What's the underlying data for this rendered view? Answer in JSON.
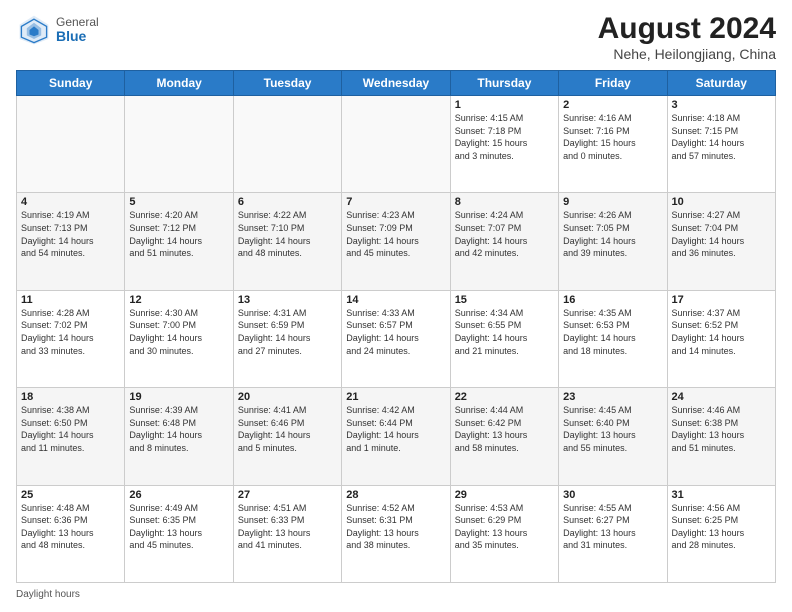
{
  "header": {
    "logo_general": "General",
    "logo_blue": "Blue",
    "title": "August 2024",
    "subtitle": "Nehe, Heilongjiang, China"
  },
  "days_of_week": [
    "Sunday",
    "Monday",
    "Tuesday",
    "Wednesday",
    "Thursday",
    "Friday",
    "Saturday"
  ],
  "footer_text": "Daylight hours",
  "weeks": [
    [
      {
        "day": "",
        "info": ""
      },
      {
        "day": "",
        "info": ""
      },
      {
        "day": "",
        "info": ""
      },
      {
        "day": "",
        "info": ""
      },
      {
        "day": "1",
        "info": "Sunrise: 4:15 AM\nSunset: 7:18 PM\nDaylight: 15 hours\nand 3 minutes."
      },
      {
        "day": "2",
        "info": "Sunrise: 4:16 AM\nSunset: 7:16 PM\nDaylight: 15 hours\nand 0 minutes."
      },
      {
        "day": "3",
        "info": "Sunrise: 4:18 AM\nSunset: 7:15 PM\nDaylight: 14 hours\nand 57 minutes."
      }
    ],
    [
      {
        "day": "4",
        "info": "Sunrise: 4:19 AM\nSunset: 7:13 PM\nDaylight: 14 hours\nand 54 minutes."
      },
      {
        "day": "5",
        "info": "Sunrise: 4:20 AM\nSunset: 7:12 PM\nDaylight: 14 hours\nand 51 minutes."
      },
      {
        "day": "6",
        "info": "Sunrise: 4:22 AM\nSunset: 7:10 PM\nDaylight: 14 hours\nand 48 minutes."
      },
      {
        "day": "7",
        "info": "Sunrise: 4:23 AM\nSunset: 7:09 PM\nDaylight: 14 hours\nand 45 minutes."
      },
      {
        "day": "8",
        "info": "Sunrise: 4:24 AM\nSunset: 7:07 PM\nDaylight: 14 hours\nand 42 minutes."
      },
      {
        "day": "9",
        "info": "Sunrise: 4:26 AM\nSunset: 7:05 PM\nDaylight: 14 hours\nand 39 minutes."
      },
      {
        "day": "10",
        "info": "Sunrise: 4:27 AM\nSunset: 7:04 PM\nDaylight: 14 hours\nand 36 minutes."
      }
    ],
    [
      {
        "day": "11",
        "info": "Sunrise: 4:28 AM\nSunset: 7:02 PM\nDaylight: 14 hours\nand 33 minutes."
      },
      {
        "day": "12",
        "info": "Sunrise: 4:30 AM\nSunset: 7:00 PM\nDaylight: 14 hours\nand 30 minutes."
      },
      {
        "day": "13",
        "info": "Sunrise: 4:31 AM\nSunset: 6:59 PM\nDaylight: 14 hours\nand 27 minutes."
      },
      {
        "day": "14",
        "info": "Sunrise: 4:33 AM\nSunset: 6:57 PM\nDaylight: 14 hours\nand 24 minutes."
      },
      {
        "day": "15",
        "info": "Sunrise: 4:34 AM\nSunset: 6:55 PM\nDaylight: 14 hours\nand 21 minutes."
      },
      {
        "day": "16",
        "info": "Sunrise: 4:35 AM\nSunset: 6:53 PM\nDaylight: 14 hours\nand 18 minutes."
      },
      {
        "day": "17",
        "info": "Sunrise: 4:37 AM\nSunset: 6:52 PM\nDaylight: 14 hours\nand 14 minutes."
      }
    ],
    [
      {
        "day": "18",
        "info": "Sunrise: 4:38 AM\nSunset: 6:50 PM\nDaylight: 14 hours\nand 11 minutes."
      },
      {
        "day": "19",
        "info": "Sunrise: 4:39 AM\nSunset: 6:48 PM\nDaylight: 14 hours\nand 8 minutes."
      },
      {
        "day": "20",
        "info": "Sunrise: 4:41 AM\nSunset: 6:46 PM\nDaylight: 14 hours\nand 5 minutes."
      },
      {
        "day": "21",
        "info": "Sunrise: 4:42 AM\nSunset: 6:44 PM\nDaylight: 14 hours\nand 1 minute."
      },
      {
        "day": "22",
        "info": "Sunrise: 4:44 AM\nSunset: 6:42 PM\nDaylight: 13 hours\nand 58 minutes."
      },
      {
        "day": "23",
        "info": "Sunrise: 4:45 AM\nSunset: 6:40 PM\nDaylight: 13 hours\nand 55 minutes."
      },
      {
        "day": "24",
        "info": "Sunrise: 4:46 AM\nSunset: 6:38 PM\nDaylight: 13 hours\nand 51 minutes."
      }
    ],
    [
      {
        "day": "25",
        "info": "Sunrise: 4:48 AM\nSunset: 6:36 PM\nDaylight: 13 hours\nand 48 minutes."
      },
      {
        "day": "26",
        "info": "Sunrise: 4:49 AM\nSunset: 6:35 PM\nDaylight: 13 hours\nand 45 minutes."
      },
      {
        "day": "27",
        "info": "Sunrise: 4:51 AM\nSunset: 6:33 PM\nDaylight: 13 hours\nand 41 minutes."
      },
      {
        "day": "28",
        "info": "Sunrise: 4:52 AM\nSunset: 6:31 PM\nDaylight: 13 hours\nand 38 minutes."
      },
      {
        "day": "29",
        "info": "Sunrise: 4:53 AM\nSunset: 6:29 PM\nDaylight: 13 hours\nand 35 minutes."
      },
      {
        "day": "30",
        "info": "Sunrise: 4:55 AM\nSunset: 6:27 PM\nDaylight: 13 hours\nand 31 minutes."
      },
      {
        "day": "31",
        "info": "Sunrise: 4:56 AM\nSunset: 6:25 PM\nDaylight: 13 hours\nand 28 minutes."
      }
    ]
  ]
}
